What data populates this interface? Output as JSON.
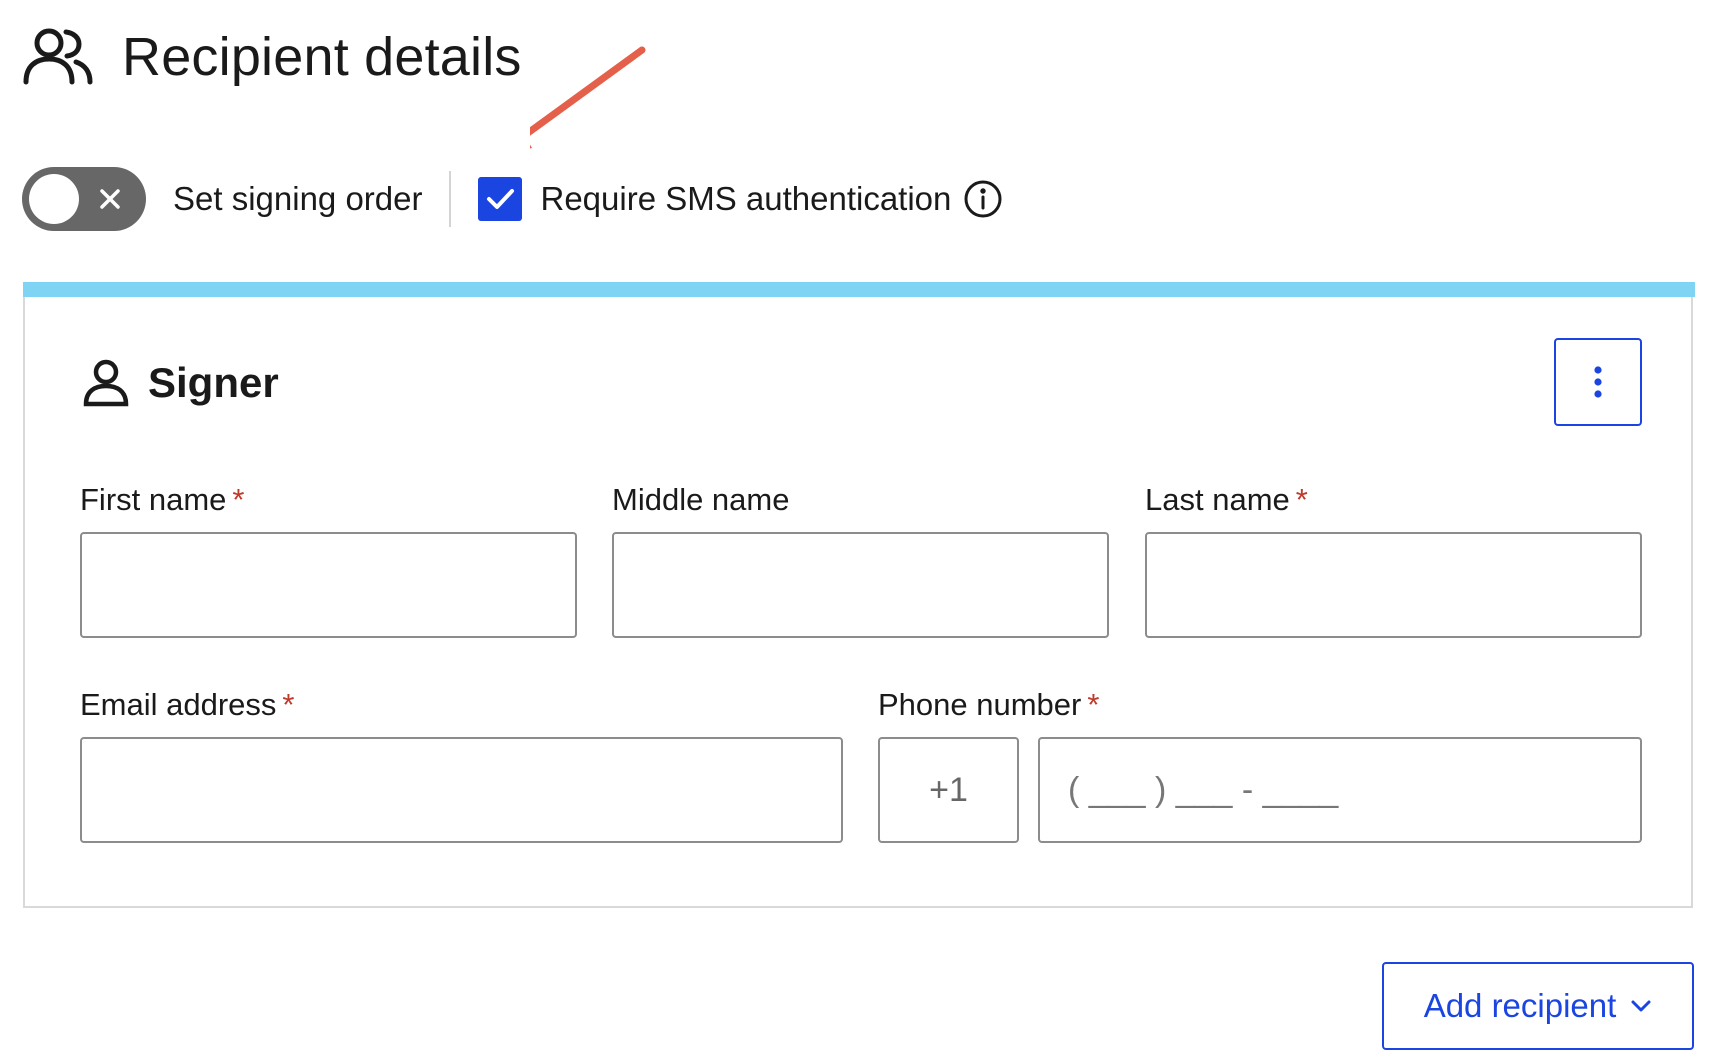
{
  "header": {
    "title": "Recipient details",
    "icon": "users-icon"
  },
  "options": {
    "signing_order": {
      "label": "Set signing order",
      "enabled": false
    },
    "sms_auth": {
      "label": "Require SMS authentication",
      "checked": true,
      "info_icon": "info-icon"
    }
  },
  "annotation": {
    "icon": "red-arrow",
    "color": "#e5604a"
  },
  "card": {
    "accent_color": "#7fd4f3",
    "title": "Signer",
    "icon": "user-icon",
    "menu_icon": "more-vertical-icon",
    "fields": {
      "first_name": {
        "label": "First name",
        "required": "*",
        "value": ""
      },
      "middle_name": {
        "label": "Middle name",
        "value": ""
      },
      "last_name": {
        "label": "Last name",
        "required": "*",
        "value": ""
      },
      "email": {
        "label": "Email address",
        "required": "*",
        "value": ""
      },
      "phone": {
        "label": "Phone number",
        "required": "*",
        "country_code": "+1",
        "placeholder": "( ___ ) ___ - ____"
      }
    }
  },
  "add_recipient": {
    "label": "Add recipient",
    "icon": "chevron-down-icon"
  },
  "colors": {
    "primary": "#1b45e0",
    "required": "#c0392b",
    "toggle_off": "#676767"
  }
}
